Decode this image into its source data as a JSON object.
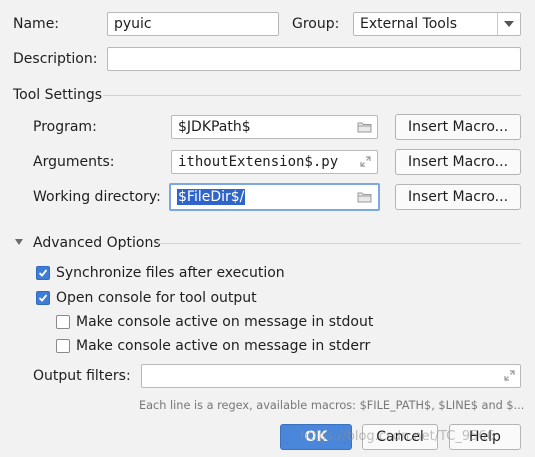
{
  "form": {
    "name_label": "Name:",
    "name_value": "pyuic",
    "group_label": "Group:",
    "group_value": "External Tools",
    "description_label": "Description:",
    "description_value": ""
  },
  "tool_settings": {
    "title": "Tool Settings",
    "program_label": "Program:",
    "program_value": "$JDKPath$",
    "arguments_label": "Arguments:",
    "arguments_value": "ithoutExtension$.py",
    "workdir_label": "Working directory:",
    "workdir_value": "$FileDir$/",
    "insert_macro_label": "Insert Macro..."
  },
  "advanced": {
    "title": "Advanced Options",
    "sync_label": "Synchronize files after execution",
    "sync_checked": true,
    "console_label": "Open console for tool output",
    "console_checked": true,
    "stdout_label": "Make console active on message in stdout",
    "stdout_checked": false,
    "stderr_label": "Make console active on message in stderr",
    "stderr_checked": false,
    "output_filters_label": "Output filters:",
    "output_filters_value": "",
    "hint": "Each line is a regex, available macros: $FILE_PATH$, $LINE$ and $..."
  },
  "footer": {
    "ok_label": "OK",
    "cancel_label": "Cancel",
    "help_label": "Help",
    "watermark": "https://blog.csdn.net/TC_9566"
  },
  "icons": {
    "folder": "folder-icon",
    "expand": "expand-icon",
    "dropdown": "chevron-down-icon",
    "disclosure": "triangle-down-icon",
    "checkmark": "checkmark-icon"
  }
}
